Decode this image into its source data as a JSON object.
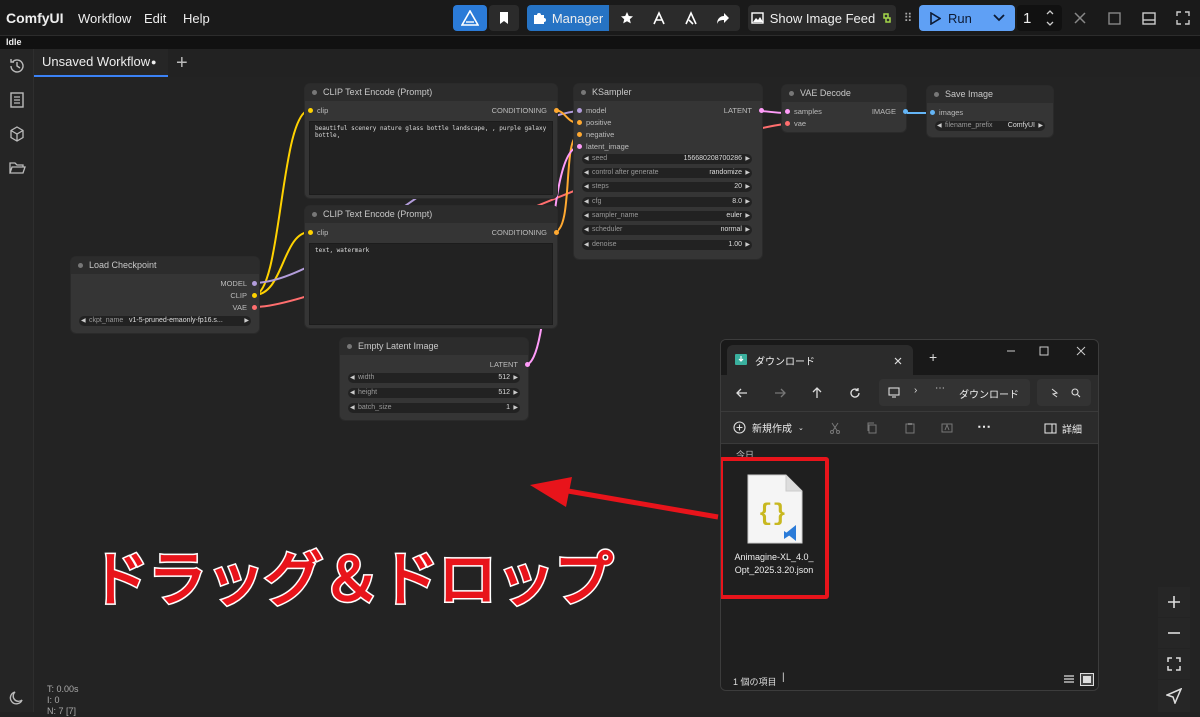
{
  "app": {
    "title": "ComfyUI",
    "status": "Idle"
  },
  "menu": {
    "workflow": "Workflow",
    "edit": "Edit",
    "help": "Help"
  },
  "toolbar": {
    "manager": "Manager",
    "show_feed": "Show Image Feed",
    "run": "Run",
    "queue_count": "1"
  },
  "tabs": {
    "active": "Unsaved Workflow",
    "dirty_marker": "●",
    "add": "+"
  },
  "nodes": {
    "clip1": {
      "title": "CLIP Text Encode (Prompt)",
      "in": "clip",
      "out": "CONDITIONING",
      "text": "beautiful scenery nature glass bottle landscape, , purple galaxy bottle,"
    },
    "clip2": {
      "title": "CLIP Text Encode (Prompt)",
      "in": "clip",
      "out": "CONDITIONING",
      "text": "text, watermark"
    },
    "ksampler": {
      "title": "KSampler",
      "in_model": "model",
      "in_positive": "positive",
      "in_negative": "negative",
      "in_latent": "latent_image",
      "out": "LATENT",
      "w_seed_l": "seed",
      "w_seed_v": "156680208700286",
      "w_ctrl_l": "control after generate",
      "w_ctrl_v": "randomize",
      "w_steps_l": "steps",
      "w_steps_v": "20",
      "w_cfg_l": "cfg",
      "w_cfg_v": "8.0",
      "w_sampler_l": "sampler_name",
      "w_sampler_v": "euler",
      "w_sched_l": "scheduler",
      "w_sched_v": "normal",
      "w_denoise_l": "denoise",
      "w_denoise_v": "1.00"
    },
    "vae": {
      "title": "VAE Decode",
      "in_samples": "samples",
      "in_vae": "vae",
      "out": "IMAGE"
    },
    "save": {
      "title": "Save Image",
      "in": "images",
      "w_prefix_l": "filename_prefix",
      "w_prefix_v": "ComfyUI"
    },
    "ckpt": {
      "title": "Load Checkpoint",
      "out_model": "MODEL",
      "out_clip": "CLIP",
      "out_vae": "VAE",
      "w_name_l": "ckpt_name",
      "w_name_v": "v1-5-pruned-emaonly-fp16.s..."
    },
    "latent": {
      "title": "Empty Latent Image",
      "out": "LATENT",
      "w_width_l": "width",
      "w_width_v": "512",
      "w_height_l": "height",
      "w_height_v": "512",
      "w_batch_l": "batch_size",
      "w_batch_v": "1"
    }
  },
  "stats": {
    "t": "T: 0.00s",
    "i": "I: 0",
    "n": "N: 7 [7]"
  },
  "explorer": {
    "tab_title": "ダウンロード",
    "address": "ダウンロード",
    "new_label": "新規作成",
    "details": "詳細",
    "group_label": "今日",
    "file_name": "Animagine-XL_4.0_Opt_2025.3.20.json",
    "status": "1 個の項目"
  },
  "annotation": {
    "text": "ドラッグ＆ドロップ",
    "color": "#e8141b"
  },
  "colors": {
    "accent": "#2b7bd8",
    "run": "#5fa0f5",
    "manager": "#2673c4",
    "wire_clip": "#ffd200",
    "wire_model": "#b39ddb",
    "wire_latent": "#ff9cf9",
    "wire_cond": "#ffa931",
    "wire_vae": "#ff6e6e",
    "wire_image": "#64b5f6"
  }
}
